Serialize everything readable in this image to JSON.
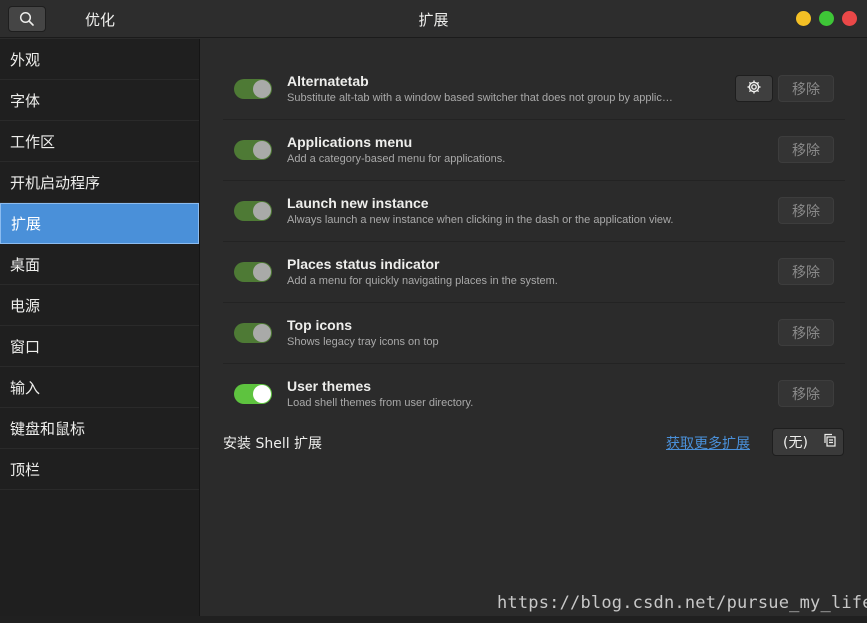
{
  "header": {
    "left_title": "优化",
    "title": "扩展"
  },
  "sidebar": {
    "items": [
      {
        "label": "外观"
      },
      {
        "label": "字体"
      },
      {
        "label": "工作区"
      },
      {
        "label": "开机启动程序"
      },
      {
        "label": "扩展",
        "selected": true
      },
      {
        "label": "桌面"
      },
      {
        "label": "电源"
      },
      {
        "label": "窗口"
      },
      {
        "label": "输入"
      },
      {
        "label": "键盘和鼠标"
      },
      {
        "label": "顶栏"
      }
    ]
  },
  "extensions": [
    {
      "name": "Alternatetab",
      "description": "Substitute alt-tab with a window based switcher that does not group by applic…",
      "enabled": true,
      "has_settings": true,
      "remove_label": "移除"
    },
    {
      "name": "Applications menu",
      "description": "Add a category-based menu for applications.",
      "enabled": true,
      "has_settings": false,
      "remove_label": "移除"
    },
    {
      "name": "Launch new instance",
      "description": "Always launch a new instance when clicking in the dash or the application view.",
      "enabled": true,
      "has_settings": false,
      "remove_label": "移除"
    },
    {
      "name": "Places status indicator",
      "description": "Add a menu for quickly navigating places in the system.",
      "enabled": true,
      "has_settings": false,
      "remove_label": "移除"
    },
    {
      "name": "Top icons",
      "description": "Shows legacy tray icons on top",
      "enabled": true,
      "has_settings": false,
      "remove_label": "移除"
    },
    {
      "name": "User themes",
      "description": "Load shell themes from user directory.",
      "enabled": true,
      "active": true,
      "has_settings": false,
      "remove_label": "移除"
    }
  ],
  "footer": {
    "install_label": "安装 Shell 扩展",
    "more_link": "获取更多扩展",
    "file_button": "(无)"
  },
  "watermark": "https://blog.csdn.net/pursue_my_life",
  "colors": {
    "accent": "#4a90d9",
    "switch_on": "#5ec33f",
    "switch_dim": "#4e7a35",
    "minimize": "#f4c025",
    "maximize": "#3ec637",
    "close": "#ea4848"
  },
  "icons": {
    "search": "search-icon",
    "settings": "gear-icon",
    "file": "file-icon"
  }
}
